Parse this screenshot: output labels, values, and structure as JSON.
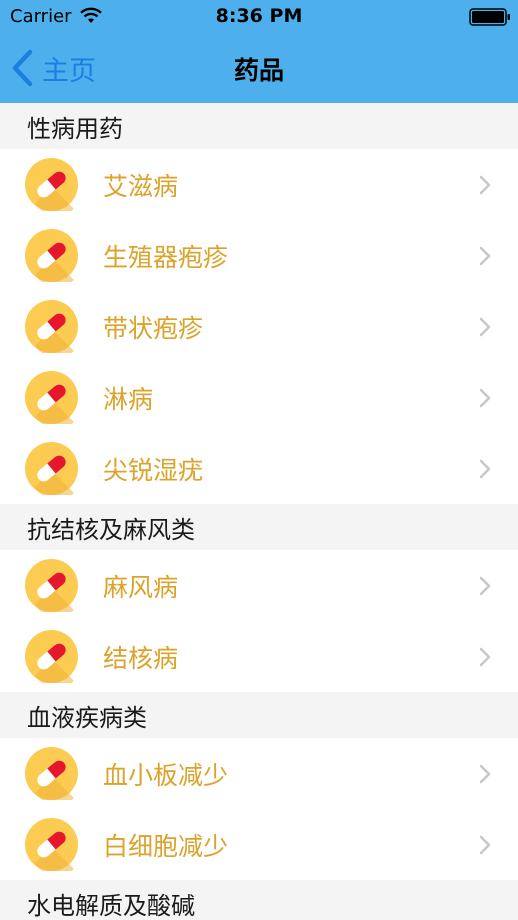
{
  "status": {
    "carrier": "Carrier",
    "time": "8:36 PM"
  },
  "nav": {
    "back_label": "主页",
    "title": "药品"
  },
  "sections": [
    {
      "title": "性病用药",
      "items": [
        "艾滋病",
        "生殖器疱疹",
        "带状疱疹",
        "淋病",
        "尖锐湿疣"
      ]
    },
    {
      "title": "抗结核及麻风类",
      "items": [
        "麻风病",
        "结核病"
      ]
    },
    {
      "title": "血液疾病类",
      "items": [
        "血小板减少",
        "白细胞减少"
      ]
    },
    {
      "title": "水电解质及酸碱",
      "items": []
    }
  ],
  "colors": {
    "navbar_bg": "#4db0ec",
    "back_tint": "#1a7fe0",
    "item_text": "#dba32b",
    "icon_bg": "#fccb52",
    "pill_red": "#e6172c",
    "section_bg": "#f4f4f4"
  },
  "icons": {
    "row_icon": "pill-icon",
    "disclosure": "chevron-right-icon"
  }
}
